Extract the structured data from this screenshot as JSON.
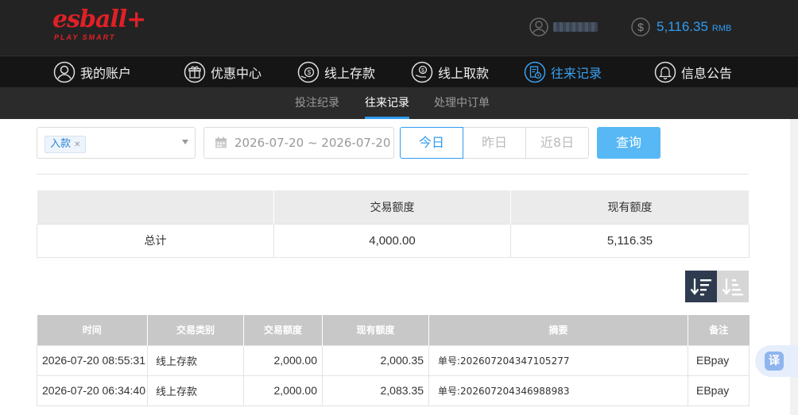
{
  "brand": {
    "logo_main": "esball+",
    "logo_sub": "PLAY SMART"
  },
  "account": {
    "balance": "5,116.35",
    "currency": "RMB"
  },
  "main_nav": [
    {
      "label": "我的账户",
      "icon": "user-circle-icon"
    },
    {
      "label": "优惠中心",
      "icon": "gift-icon"
    },
    {
      "label": "线上存款",
      "icon": "deposit-coin-icon"
    },
    {
      "label": "线上取款",
      "icon": "withdraw-hand-icon"
    },
    {
      "label": "往来记录",
      "icon": "history-record-icon",
      "active": true
    },
    {
      "label": "信息公告",
      "icon": "bell-icon"
    }
  ],
  "sub_nav": [
    {
      "label": "投注纪录"
    },
    {
      "label": "往来记录",
      "active": true
    },
    {
      "label": "处理中订单"
    }
  ],
  "filters": {
    "type_tag": "入款",
    "date_range": "2026-07-20 ~ 2026-07-20",
    "quick_ranges": [
      "今日",
      "昨日",
      "近8日"
    ],
    "query_label": "查询"
  },
  "summary": {
    "headers": [
      "",
      "交易额度",
      "现有额度"
    ],
    "row": {
      "label": "总计",
      "amount": "4,000.00",
      "balance": "5,116.35"
    }
  },
  "records": {
    "headers": [
      "时间",
      "交易类别",
      "交易额度",
      "现有额度",
      "摘要",
      "备注"
    ],
    "rows": [
      {
        "time": "2026-07-20 08:55:31",
        "type": "线上存款",
        "amount": "2,000.00",
        "balance": "2,000.35",
        "memo": "单号:202607204347105277",
        "note": "EBpay"
      },
      {
        "time": "2026-07-20 06:34:40",
        "type": "线上存款",
        "amount": "2,000.00",
        "balance": "2,083.35",
        "memo": "单号:202607204346988983",
        "note": "EBpay"
      }
    ]
  },
  "translate_label": "译",
  "colors": {
    "accent": "#2f9cf2",
    "brand_red": "#e02027",
    "header_bg": "#232323"
  }
}
